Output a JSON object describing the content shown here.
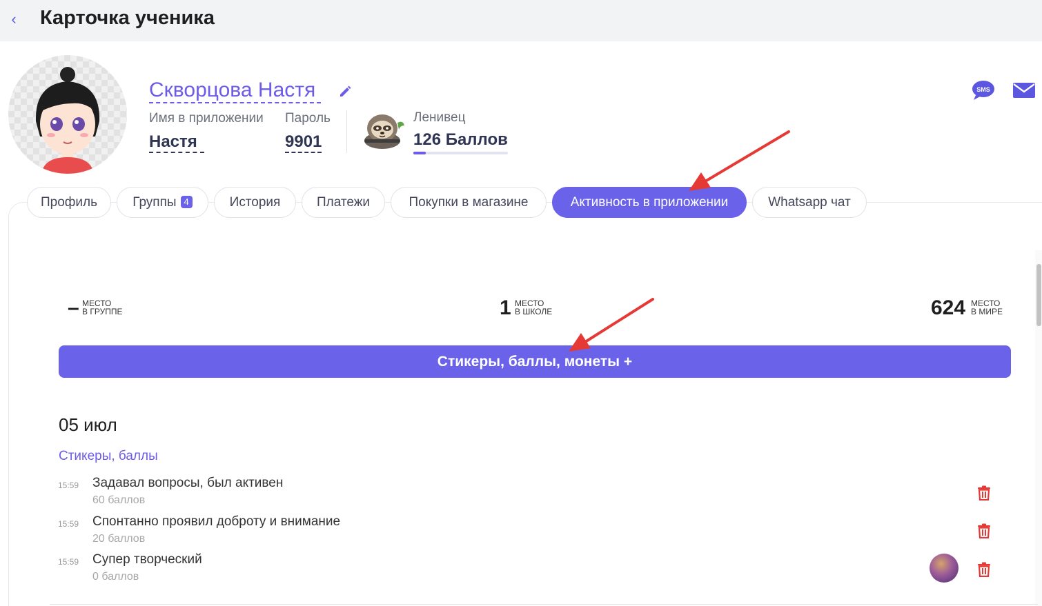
{
  "header": {
    "back_label": "‹",
    "title": "Карточка ученика"
  },
  "student": {
    "name": "Скворцова Настя",
    "app_name_label": "Имя в приложении",
    "app_name_value": "Настя",
    "password_label": "Пароль",
    "password_value": "9901",
    "level_name": "Ленивец",
    "points_text": "126 Баллов",
    "points_progress": 0.13
  },
  "contact_icons": {
    "sms_label": "SMS"
  },
  "tabs": [
    {
      "label": "Профиль"
    },
    {
      "label": "Группы",
      "badge": "4"
    },
    {
      "label": "История"
    },
    {
      "label": "Платежи"
    },
    {
      "label": "Покупки в магазине"
    },
    {
      "label": "Активность в приложении",
      "active": true
    },
    {
      "label": "Whatsapp чат"
    }
  ],
  "ranks": {
    "group": {
      "value": "–",
      "line1": "место",
      "line2": "в группе"
    },
    "school": {
      "value": "1",
      "line1": "место",
      "line2": "в школе"
    },
    "world": {
      "value": "624",
      "line1": "место",
      "line2": "в мире"
    }
  },
  "main_button_label": "Стикеры, баллы, монеты +",
  "activity": {
    "date": "05 июл",
    "section_title": "Стикеры, баллы",
    "items": [
      {
        "time": "15:59",
        "text": "Задавал вопросы, был активен",
        "points": "60 баллов"
      },
      {
        "time": "15:59",
        "text": "Спонтанно проявил доброту и внимание",
        "points": "20 баллов"
      },
      {
        "time": "15:59",
        "text": "Супер творческий",
        "points": "0 баллов"
      }
    ]
  },
  "colors": {
    "accent": "#6b62ea",
    "delete": "#e53935",
    "annotation_arrow": "#e53935"
  }
}
